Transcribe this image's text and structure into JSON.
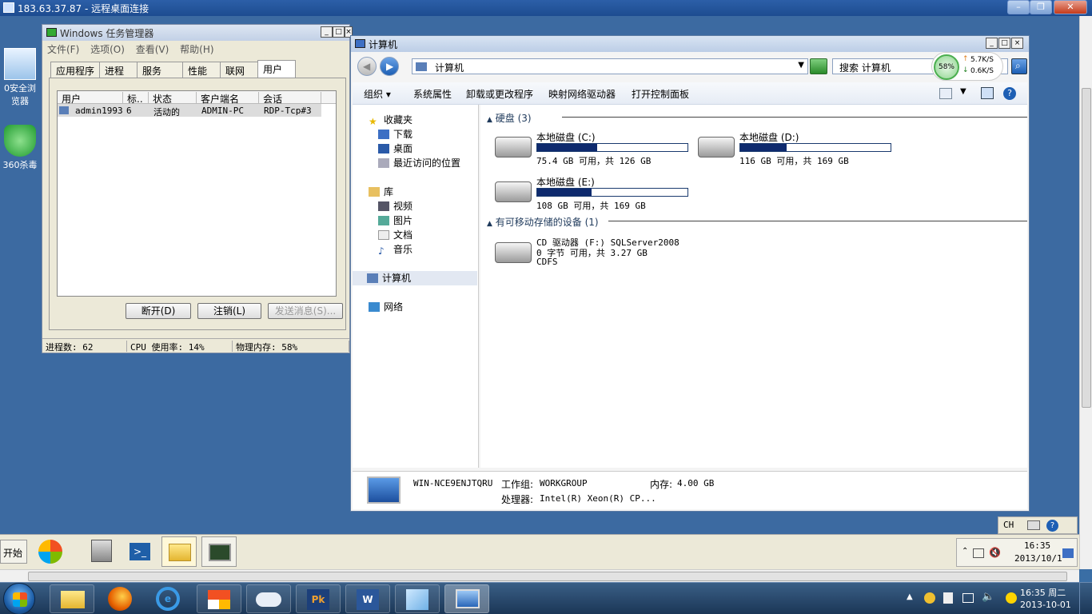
{
  "rdp": {
    "title": "183.63.37.87 - 远程桌面连接",
    "minimize": "–",
    "restore": "❐",
    "close": "✕"
  },
  "desktop": {
    "icons": [
      {
        "label": "0安全浏览器",
        "icon": "browser-icon"
      },
      {
        "label": "360杀毒",
        "icon": "shield-icon"
      }
    ]
  },
  "taskmgr": {
    "title": "Windows 任务管理器",
    "menu": [
      "文件(F)",
      "选项(O)",
      "查看(V)",
      "帮助(H)"
    ],
    "tabs": [
      "应用程序",
      "进程",
      "服务",
      "性能",
      "联网",
      "用户"
    ],
    "columns": [
      "用户",
      "标..",
      "状态",
      "客户端名",
      "会话"
    ],
    "rows": [
      {
        "user": "admin1993",
        "id": "6",
        "status": "活动的",
        "client": "ADMIN-PC",
        "session": "RDP-Tcp#3"
      }
    ],
    "buttons": {
      "disconnect": "断开(D)",
      "logoff": "注销(L)",
      "send": "发送消息(S)..."
    },
    "status": {
      "processes": "进程数: 62",
      "cpu": "CPU 使用率: 14%",
      "mem": "物理内存: 58%"
    }
  },
  "explorer": {
    "title": "计算机",
    "address": "计算机",
    "search_placeholder": "搜索 计算机",
    "net_meter": {
      "percent": "58%",
      "up": "5.7K/S",
      "down": "0.6K/S"
    },
    "toolbar": [
      "组织",
      "系统属性",
      "卸载或更改程序",
      "映射网络驱动器",
      "打开控制面板"
    ],
    "nav": {
      "favorites": "收藏夹",
      "fav_items": [
        "下载",
        "桌面",
        "最近访问的位置"
      ],
      "libraries": "库",
      "lib_items": [
        "视频",
        "图片",
        "文档",
        "音乐"
      ],
      "computer": "计算机",
      "network": "网络"
    },
    "groups": {
      "hdd": "硬盘 (3)",
      "removable": "有可移动存储的设备 (1)"
    },
    "drives": [
      {
        "name": "本地磁盘 (C:)",
        "free": "75.4 GB 可用，共 126 GB",
        "used_fraction": 0.4
      },
      {
        "name": "本地磁盘 (D:)",
        "free": "116 GB 可用，共 169 GB",
        "used_fraction": 0.31
      },
      {
        "name": "本地磁盘 (E:)",
        "free": "108 GB 可用，共 169 GB",
        "used_fraction": 0.36
      }
    ],
    "cd": {
      "name": "CD 驱动器 (F:) SQLServer2008",
      "free": "0 字节 可用，共 3.27 GB",
      "fs": "CDFS"
    },
    "details": {
      "computer_name": "WIN-NCE9ENJTQRU",
      "workgroup_label": "工作组:",
      "workgroup": "WORKGROUP",
      "memory_label": "内存:",
      "memory": "4.00 GB",
      "cpu_label": "处理器:",
      "cpu": "Intel(R) Xeon(R) CP..."
    }
  },
  "remote_taskbar": {
    "start": "开始",
    "lang": "CH",
    "time": "16:35",
    "date": "2013/10/1"
  },
  "taskbar": {
    "time": "16:35 周二",
    "date": "2013-10-01"
  }
}
